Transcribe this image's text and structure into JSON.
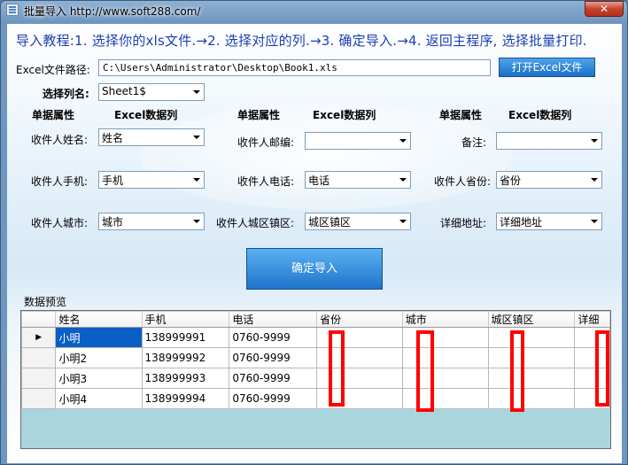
{
  "window": {
    "title": "批量导入   http://www.soft288.com/",
    "close": "✕"
  },
  "tutorial": "导入教程:1. 选择你的xls文件.→2. 选择对应的列.→3. 确定导入.→4. 返回主程序, 选择批量打印.",
  "file": {
    "label": "Excel文件路径:",
    "path": "C:\\Users\\Administrator\\Desktop\\Book1.xls",
    "open_button": "打开Excel文件"
  },
  "sheet": {
    "label": "选择列名:",
    "value": "Sheet1$"
  },
  "headers": {
    "attr": "单据属性",
    "col": "Excel数据列"
  },
  "fields": {
    "name": {
      "label": "收件人姓名:",
      "value": "姓名"
    },
    "phone": {
      "label": "收件人手机:",
      "value": "手机"
    },
    "city": {
      "label": "收件人城市:",
      "value": "城市"
    },
    "postcode": {
      "label": "收件人邮编:",
      "value": ""
    },
    "tel": {
      "label": "收件人电话:",
      "value": "电话"
    },
    "district": {
      "label": "收件人城区镇区:",
      "value": "城区镇区"
    },
    "remark": {
      "label": "备注:",
      "value": ""
    },
    "province": {
      "label": "收件人省份:",
      "value": "省份"
    },
    "address": {
      "label": "详细地址:",
      "value": "详细地址"
    }
  },
  "confirm_button": "确定导入",
  "preview": {
    "label": "数据预览",
    "row_marker": "▶",
    "columns": [
      "姓名",
      "手机",
      "电话",
      "省份",
      "城市",
      "城区镇区",
      "详细"
    ],
    "rows": [
      [
        "小明",
        "138999991",
        "0760-9999",
        "",
        "",
        "",
        ""
      ],
      [
        "小明2",
        "138999992",
        "0760-9999",
        "",
        "",
        "",
        ""
      ],
      [
        "小明3",
        "138999993",
        "0760-9999",
        "",
        "",
        "",
        ""
      ],
      [
        "小明4",
        "138999994",
        "0760-9999",
        "",
        "",
        "",
        ""
      ]
    ]
  }
}
